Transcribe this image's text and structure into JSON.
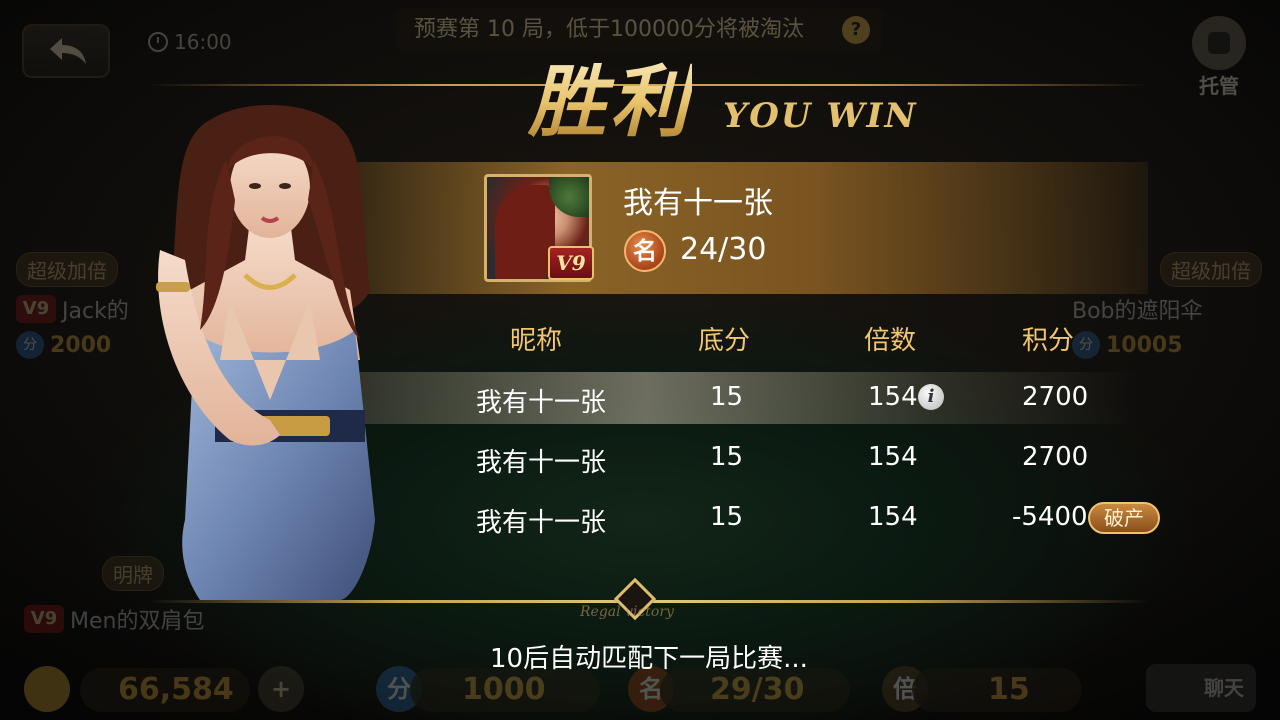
{
  "background": {
    "clock": "16:00",
    "prelim_notice": "预赛第 10 局，低于100000分将被淘汰",
    "robot_label": "托管",
    "left_player": {
      "tag": "超级加倍",
      "vip": "V9",
      "name": "Jack的",
      "score": "2000"
    },
    "right_player": {
      "tag": "超级加倍",
      "name": "Bob的遮阳伞",
      "score": "10005"
    },
    "bottom_left_player": {
      "tag": "明牌",
      "vip": "V9",
      "name": "Men的双肩包"
    },
    "bottom_bar": {
      "coins": "66,584",
      "score_icon": "分",
      "score": "1000",
      "rank_icon": "名",
      "rank": "29/30",
      "multiplier_icon": "倍",
      "multiplier": "15",
      "chat_label": "聊天"
    }
  },
  "result": {
    "title_zh": "胜利",
    "title_en": "YOU WIN",
    "player_name": "我有十一张",
    "vip_level": "V9",
    "rank_icon": "名",
    "rank": "24/30",
    "columns": [
      "昵称",
      "底分",
      "倍数",
      "积分"
    ],
    "rows": [
      {
        "name": "我有十一张",
        "base": "15",
        "multiplier": "154",
        "score": "2700",
        "info": true
      },
      {
        "name": "我有十一张",
        "base": "15",
        "multiplier": "154",
        "score": "2700"
      },
      {
        "name": "我有十一张",
        "base": "15",
        "multiplier": "154",
        "score": "-5400",
        "badge": "破产"
      }
    ],
    "ornament_text": "Regal victory",
    "countdown_text": "10后自动匹配下一局比赛..."
  },
  "colors": {
    "gold": "#f0c66e",
    "accent_brown": "#8a6328",
    "bankrupt": "#a8622a"
  }
}
